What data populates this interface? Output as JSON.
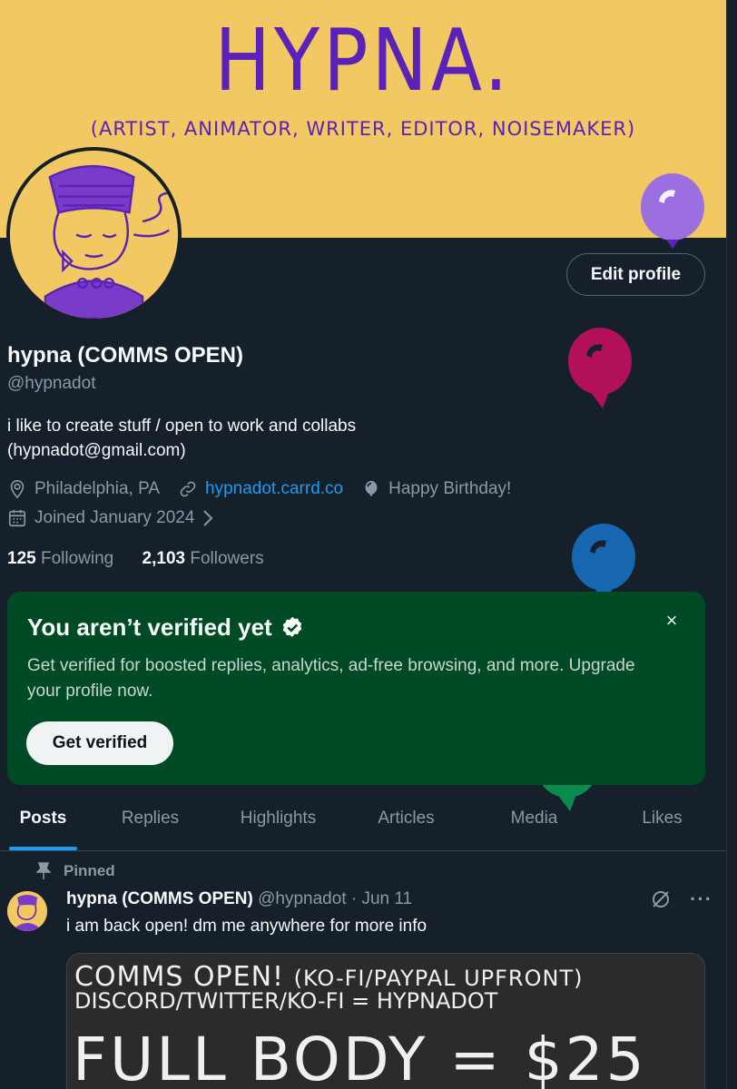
{
  "banner": {
    "title": "HYPNA.",
    "subtitle": "(ARTIST, ANIMATOR, WRITER, EDITOR, NOISEMAKER)"
  },
  "profile": {
    "edit_label": "Edit profile",
    "name": "hypna (COMMS OPEN)",
    "handle": "@hypnadot",
    "bio_line1": "i like to create stuff / open to work and collabs",
    "bio_line2": "(hypnadot@gmail.com)",
    "location": "Philadelphia, PA",
    "website": "hypnadot.carrd.co",
    "birthday": "Happy Birthday!",
    "joined": "Joined January 2024",
    "following_count": "125",
    "following_label": "Following",
    "followers_count": "2,103",
    "followers_label": "Followers"
  },
  "verify": {
    "title": "You aren’t verified yet",
    "desc": "Get verified for boosted replies, analytics, ad-free browsing, and more. Upgrade your profile now.",
    "button": "Get verified",
    "close": "×"
  },
  "tabs": [
    {
      "label": "Posts"
    },
    {
      "label": "Replies"
    },
    {
      "label": "Highlights"
    },
    {
      "label": "Articles"
    },
    {
      "label": "Media"
    },
    {
      "label": "Likes"
    }
  ],
  "post": {
    "pinned_label": "Pinned",
    "author": "hypna (COMMS OPEN)",
    "handle": "@hypnadot",
    "separator": "·",
    "date": "Jun 11",
    "text": "i am back open! dm me anywhere for more info",
    "more": "···",
    "media": {
      "line1": "COMMS OPEN!",
      "line1_small": "(KO-FI/PAYPAL UPFRONT)",
      "line2": "DISCORD/TWITTER/KO-FI = HYPNADOT",
      "line3": "FULL BODY = $25"
    }
  },
  "colors": {
    "background": "#15202b",
    "banner": "#f2c862",
    "accent": "#1d9bf0",
    "verify_bg": "#004a26",
    "balloon_purple": "#9b6fe0",
    "balloon_magenta": "#b3105c",
    "balloon_blue": "#1766b0",
    "balloon_green": "#0b8a4e"
  },
  "icons": [
    "location-icon",
    "link-icon",
    "balloon-icon",
    "calendar-icon",
    "chevron-right-icon",
    "verified-badge-icon",
    "pin-icon",
    "grok-icon",
    "more-icon"
  ]
}
